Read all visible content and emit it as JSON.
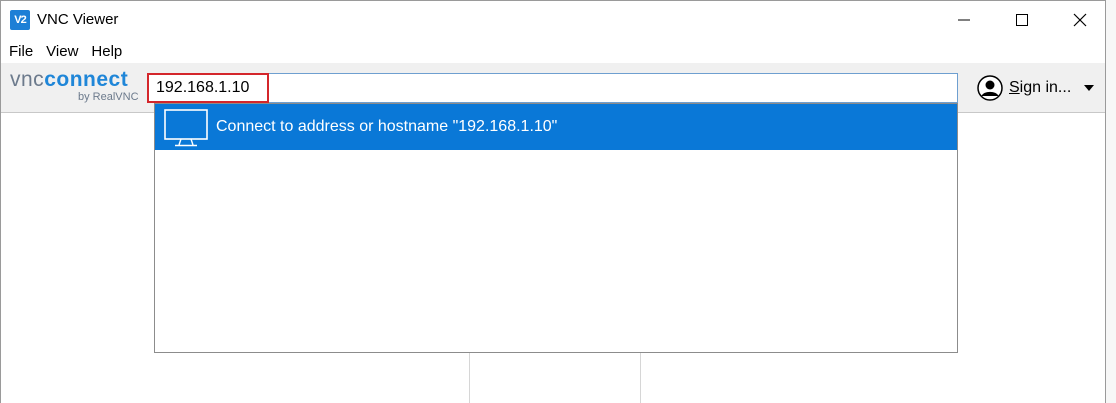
{
  "window": {
    "title": "VNC Viewer",
    "app_icon_text": "V2"
  },
  "menu": {
    "items": [
      "File",
      "View",
      "Help"
    ]
  },
  "toolbar": {
    "logo_vnc": "vnc",
    "logo_connect": "connect",
    "logo_by": "by RealVNC",
    "address_value": "192.168.1.10",
    "signin_first": "S",
    "signin_rest": "ign in..."
  },
  "dropdown": {
    "suggestion": "Connect to address or hostname \"192.168.1.10\""
  },
  "colors": {
    "accent": "#0a78d7",
    "highlight_border": "#d4262b",
    "brand_blue": "#1f86d8"
  },
  "icons": {
    "app": "vnc-viewer-icon",
    "minimize": "minimize-icon",
    "maximize": "maximize-icon",
    "close": "close-icon",
    "monitor": "monitor-icon",
    "user": "user-avatar-icon",
    "caret": "caret-down-icon"
  }
}
